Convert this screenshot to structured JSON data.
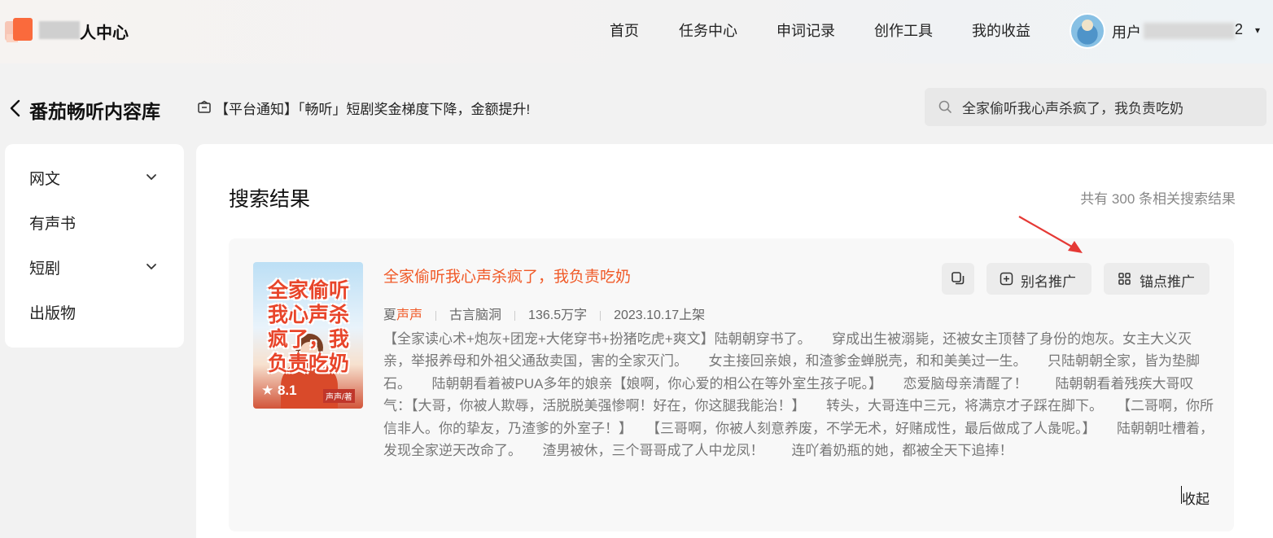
{
  "header": {
    "brand": "人中心",
    "nav": [
      "首页",
      "任务中心",
      "申词记录",
      "创作工具",
      "我的收益"
    ],
    "user_prefix": "用户",
    "user_suffix": "2"
  },
  "page": {
    "title": "番茄畅听内容库",
    "notice": "【平台通知】「畅听」短剧奖金梯度下降，金额提升!",
    "search_value": "全家偷听我心声杀疯了，我负责吃奶"
  },
  "sidebar": {
    "items": [
      {
        "label": "网文",
        "has_chevron": true
      },
      {
        "label": "有声书",
        "has_chevron": false
      },
      {
        "label": "短剧",
        "has_chevron": true
      },
      {
        "label": "出版物",
        "has_chevron": false
      }
    ]
  },
  "results": {
    "title": "搜索结果",
    "count_text": "共有 300 条相关搜索结果"
  },
  "book": {
    "title": "全家偷听我心声杀疯了，我负责吃奶",
    "cover_title": "全家偷听我心声杀疯了，我负责吃奶",
    "rating": "8.1",
    "publisher": "声声/著",
    "author_highlight": "声声",
    "author_rest": "夏",
    "genre": "古言脑洞",
    "words": "136.5万字",
    "date": "2023.10.17上架",
    "description": "【全家读心术+炮灰+团宠+大佬穿书+扮猪吃虎+爽文】陆朝朝穿书了。　　穿成出生被溺毙，还被女主顶替了身份的炮灰。女主大义灭亲，举报养母和外祖父通敌卖国，害的全家灭门。　　女主接回亲娘，和渣爹金蝉脱壳，和和美美过一生。　　只陆朝朝全家，皆为垫脚石。　　陆朝朝看着被PUA多年的娘亲【娘啊，你心爱的相公在等外室生孩子呢。】　　恋爱脑母亲清醒了！　　陆朝朝看着残疾大哥叹气：【大哥，你被人欺辱，活脱脱美强惨啊！好在，你这腿我能治！】　　转头，大哥连中三元，将满京才子踩在脚下。　　【二哥啊，你所信非人。你的挚友，乃渣爹的外室子！】　　【三哥啊，你被人刻意养废，不学无术，好赌成性，最后做成了人彘呢。】　　陆朝朝吐槽着，发现全家逆天改命了。　　渣男被休，三个哥哥成了人中龙凤！　　连吖着奶瓶的她，都被全天下追捧！",
    "buttons": {
      "copy": "",
      "alias": "别名推广",
      "anchor": "锚点推广"
    },
    "collapse_label": "收起"
  },
  "colors": {
    "accent": "#f05a28",
    "arrow": "#e53935"
  }
}
